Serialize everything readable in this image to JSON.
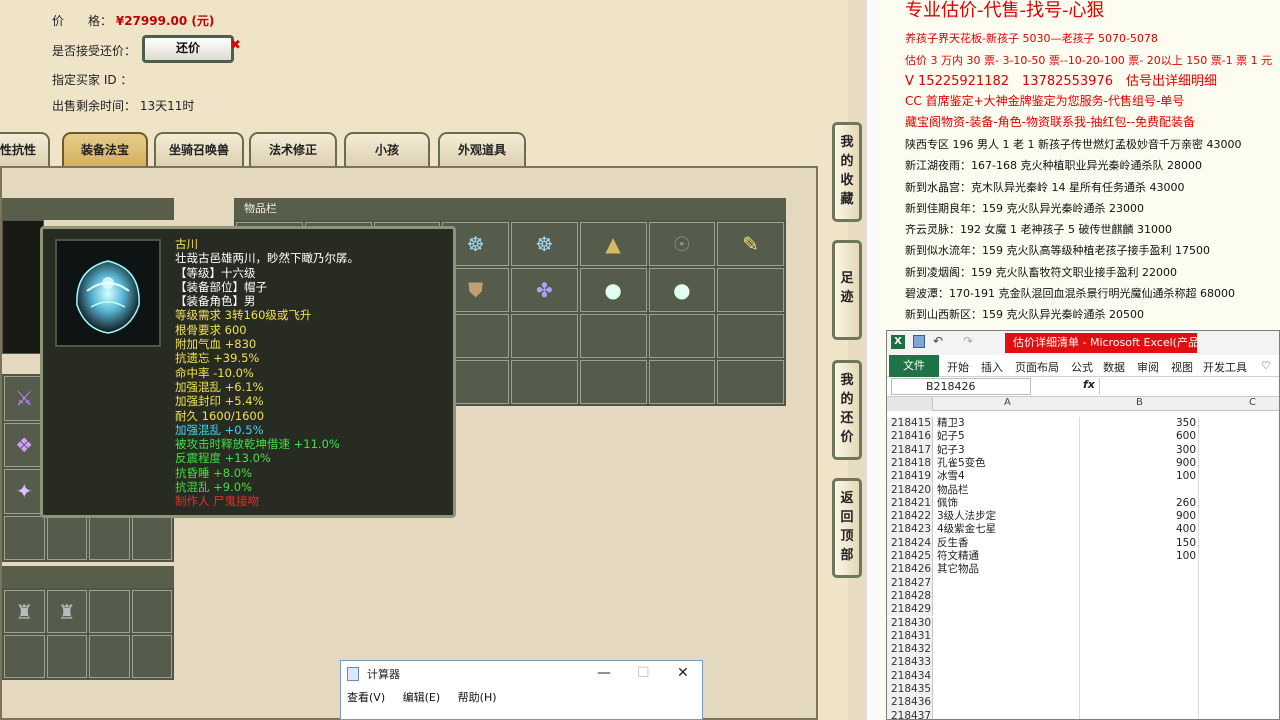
{
  "listing": {
    "price_label": "价　　格：",
    "price_value": "¥27999.00 (元)",
    "haggle_label": "是否接受还价：",
    "haggle_button": "还价",
    "haggle_close": "✖",
    "buyer_label": "指定买家 ID ：",
    "time_label": "出售剩余时间：",
    "time_value": "13天11时"
  },
  "tabs": [
    "性抗性",
    "装备法宝",
    "坐骑召唤兽",
    "法术修正",
    "小孩",
    "外观道具"
  ],
  "active_tab": 1,
  "inventory_header": "物品栏",
  "tooltip": {
    "name": "古川",
    "lines": [
      {
        "text": "壮哉古邑雄两川，眇然下瞰乃尔孱。",
        "color": "#ffffff"
      },
      {
        "text": "【等级】十六级",
        "color": "#ffffff"
      },
      {
        "text": "【装备部位】帽子",
        "color": "#ffffff"
      },
      {
        "text": "【装备角色】男",
        "color": "#ffffff"
      },
      {
        "text": "等级需求 3转160级或飞升",
        "color": "#f0e050"
      },
      {
        "text": "根骨要求 600",
        "color": "#f0e050"
      },
      {
        "text": "附加气血 +830",
        "color": "#f0e050"
      },
      {
        "text": "抗遗忘 +39.5%",
        "color": "#f0e050"
      },
      {
        "text": "命中率 -10.0%",
        "color": "#f0e050"
      },
      {
        "text": "加强混乱 +6.1%",
        "color": "#f0e050"
      },
      {
        "text": "加强封印 +5.4%",
        "color": "#f0e050"
      },
      {
        "text": "耐久 1600/1600",
        "color": "#f0e050"
      },
      {
        "text": "加强混乱 +0.5%",
        "color": "#40d8f0"
      },
      {
        "text": "被攻击时释放乾坤借速 +11.0%",
        "color": "#40e040"
      },
      {
        "text": "反震程度 +13.0%",
        "color": "#40e040"
      },
      {
        "text": "抗昏睡 +8.0%",
        "color": "#40e040"
      },
      {
        "text": "抗混乱 +9.0%",
        "color": "#40e040"
      },
      {
        "text": "制作人 尸鬼接吻",
        "color": "#e03030"
      }
    ]
  },
  "side_buttons": [
    {
      "label": "我的收藏"
    },
    {
      "label": "足迹"
    },
    {
      "label": "我的还价"
    },
    {
      "label": "返回顶部"
    }
  ],
  "calculator": {
    "title": "计算器",
    "menu": [
      "查看(V)",
      "编辑(E)",
      "帮助(H)"
    ]
  },
  "doc": {
    "heading": "专业估价-代售-找号-心狠",
    "lines": [
      {
        "text": "养孩子界天花板-新孩子 5030—老孩子 5070-5078",
        "cls": "red",
        "size": 11
      },
      {
        "text": "估价 3 万内 30 票- 3-10-50 票--10-20-100 票- 20以上 150 票-1 票 1 元",
        "cls": "red",
        "size": 11
      },
      {
        "text": "V 15225921182　13782553976　估号出详细明细",
        "cls": "red",
        "size": 13
      },
      {
        "text": "CC 首席鉴定+大神金牌鉴定为您服务-代售组号-单号",
        "cls": "red",
        "size": 12
      },
      {
        "text": "藏宝阁物资-装备-角色-物资联系我-抽红包--免费配装备",
        "cls": "red",
        "size": 12
      },
      {
        "text": "陕西专区 196 男人 1 老 1 新孩子传世燃灯孟极妙音千万亲密 43000",
        "cls": "blk",
        "size": 11
      },
      {
        "text": "新江湖夜雨：167-168 克火种植职业异光秦岭通杀队 28000",
        "cls": "blk",
        "size": 11
      },
      {
        "text": "新到水晶宫：克木队异光秦岭 14 星所有任务通杀 43000",
        "cls": "blk",
        "size": 11
      },
      {
        "text": "新到佳期良年：159 克火队异光秦岭通杀 23000",
        "cls": "blk",
        "size": 11
      },
      {
        "text": "齐云灵脉：192 女魔 1 老神孩子 5 破传世麒麟 31000",
        "cls": "blk",
        "size": 11
      },
      {
        "text": "新到似水流年：159 克火队高等级种植老孩子接手盈利 17500",
        "cls": "blk",
        "size": 11
      },
      {
        "text": "新到凌烟阁：159 克火队畜牧符文职业接手盈利 22000",
        "cls": "blk",
        "size": 11
      },
      {
        "text": "碧波潭：170-191 克金队混回血混杀景行明光魔仙通杀称超 68000",
        "cls": "blk",
        "size": 11
      },
      {
        "text": "新到山西新区：159 克火队异光秦岭通杀 20500",
        "cls": "blk",
        "size": 11
      }
    ]
  },
  "excel": {
    "title": "估价详细清单 - Microsoft Excel(产品...",
    "file_tab": "文件",
    "ribbon_tabs": [
      "开始",
      "插入",
      "页面布局",
      "公式",
      "数据",
      "审阅",
      "视图",
      "开发工具"
    ],
    "name_box": "B218426",
    "fx": "fx",
    "col_headers": [
      "A",
      "B",
      "C"
    ],
    "rows": [
      {
        "n": "218415",
        "a": "精卫3",
        "b": "350"
      },
      {
        "n": "218416",
        "a": "妃子5",
        "b": "600"
      },
      {
        "n": "218417",
        "a": "妃子3",
        "b": "300"
      },
      {
        "n": "218418",
        "a": "孔雀5变色",
        "b": "900"
      },
      {
        "n": "218419",
        "a": "冰雪4",
        "b": "100"
      },
      {
        "n": "218420",
        "a": "物品栏",
        "b": ""
      },
      {
        "n": "218421",
        "a": "佩饰",
        "b": "260"
      },
      {
        "n": "218422",
        "a": "3级人法步定",
        "b": "900"
      },
      {
        "n": "218423",
        "a": "4级紫金七星",
        "b": "400"
      },
      {
        "n": "218424",
        "a": "反生香",
        "b": "150"
      },
      {
        "n": "218425",
        "a": "符文精通",
        "b": "100"
      },
      {
        "n": "218426",
        "a": "其它物品",
        "b": ""
      },
      {
        "n": "218427",
        "a": "",
        "b": ""
      },
      {
        "n": "218428",
        "a": "",
        "b": ""
      },
      {
        "n": "218429",
        "a": "",
        "b": ""
      },
      {
        "n": "218430",
        "a": "",
        "b": ""
      },
      {
        "n": "218431",
        "a": "",
        "b": ""
      },
      {
        "n": "218432",
        "a": "",
        "b": ""
      },
      {
        "n": "218433",
        "a": "",
        "b": ""
      },
      {
        "n": "218434",
        "a": "",
        "b": ""
      },
      {
        "n": "218435",
        "a": "",
        "b": ""
      },
      {
        "n": "218436",
        "a": "",
        "b": ""
      },
      {
        "n": "218437",
        "a": "",
        "b": ""
      }
    ]
  },
  "inventory_icons": [
    "helmet-icon",
    "helmet-icon",
    "cloak-icon",
    "mask-icon",
    "staff-icon",
    "beads-icon",
    "crown-icon",
    "flame-icon",
    "shield-icon",
    "robe-icon",
    "orb-icon",
    "orb-icon"
  ]
}
